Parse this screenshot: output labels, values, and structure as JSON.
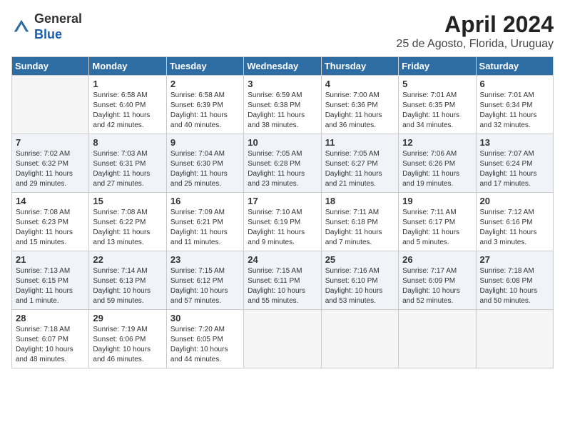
{
  "header": {
    "logo_line1": "General",
    "logo_line2": "Blue",
    "month_year": "April 2024",
    "location": "25 de Agosto, Florida, Uruguay"
  },
  "weekdays": [
    "Sunday",
    "Monday",
    "Tuesday",
    "Wednesday",
    "Thursday",
    "Friday",
    "Saturday"
  ],
  "weeks": [
    [
      {
        "day": "",
        "info": ""
      },
      {
        "day": "1",
        "info": "Sunrise: 6:58 AM\nSunset: 6:40 PM\nDaylight: 11 hours\nand 42 minutes."
      },
      {
        "day": "2",
        "info": "Sunrise: 6:58 AM\nSunset: 6:39 PM\nDaylight: 11 hours\nand 40 minutes."
      },
      {
        "day": "3",
        "info": "Sunrise: 6:59 AM\nSunset: 6:38 PM\nDaylight: 11 hours\nand 38 minutes."
      },
      {
        "day": "4",
        "info": "Sunrise: 7:00 AM\nSunset: 6:36 PM\nDaylight: 11 hours\nand 36 minutes."
      },
      {
        "day": "5",
        "info": "Sunrise: 7:01 AM\nSunset: 6:35 PM\nDaylight: 11 hours\nand 34 minutes."
      },
      {
        "day": "6",
        "info": "Sunrise: 7:01 AM\nSunset: 6:34 PM\nDaylight: 11 hours\nand 32 minutes."
      }
    ],
    [
      {
        "day": "7",
        "info": "Sunrise: 7:02 AM\nSunset: 6:32 PM\nDaylight: 11 hours\nand 29 minutes."
      },
      {
        "day": "8",
        "info": "Sunrise: 7:03 AM\nSunset: 6:31 PM\nDaylight: 11 hours\nand 27 minutes."
      },
      {
        "day": "9",
        "info": "Sunrise: 7:04 AM\nSunset: 6:30 PM\nDaylight: 11 hours\nand 25 minutes."
      },
      {
        "day": "10",
        "info": "Sunrise: 7:05 AM\nSunset: 6:28 PM\nDaylight: 11 hours\nand 23 minutes."
      },
      {
        "day": "11",
        "info": "Sunrise: 7:05 AM\nSunset: 6:27 PM\nDaylight: 11 hours\nand 21 minutes."
      },
      {
        "day": "12",
        "info": "Sunrise: 7:06 AM\nSunset: 6:26 PM\nDaylight: 11 hours\nand 19 minutes."
      },
      {
        "day": "13",
        "info": "Sunrise: 7:07 AM\nSunset: 6:24 PM\nDaylight: 11 hours\nand 17 minutes."
      }
    ],
    [
      {
        "day": "14",
        "info": "Sunrise: 7:08 AM\nSunset: 6:23 PM\nDaylight: 11 hours\nand 15 minutes."
      },
      {
        "day": "15",
        "info": "Sunrise: 7:08 AM\nSunset: 6:22 PM\nDaylight: 11 hours\nand 13 minutes."
      },
      {
        "day": "16",
        "info": "Sunrise: 7:09 AM\nSunset: 6:21 PM\nDaylight: 11 hours\nand 11 minutes."
      },
      {
        "day": "17",
        "info": "Sunrise: 7:10 AM\nSunset: 6:19 PM\nDaylight: 11 hours\nand 9 minutes."
      },
      {
        "day": "18",
        "info": "Sunrise: 7:11 AM\nSunset: 6:18 PM\nDaylight: 11 hours\nand 7 minutes."
      },
      {
        "day": "19",
        "info": "Sunrise: 7:11 AM\nSunset: 6:17 PM\nDaylight: 11 hours\nand 5 minutes."
      },
      {
        "day": "20",
        "info": "Sunrise: 7:12 AM\nSunset: 6:16 PM\nDaylight: 11 hours\nand 3 minutes."
      }
    ],
    [
      {
        "day": "21",
        "info": "Sunrise: 7:13 AM\nSunset: 6:15 PM\nDaylight: 11 hours\nand 1 minute."
      },
      {
        "day": "22",
        "info": "Sunrise: 7:14 AM\nSunset: 6:13 PM\nDaylight: 10 hours\nand 59 minutes."
      },
      {
        "day": "23",
        "info": "Sunrise: 7:15 AM\nSunset: 6:12 PM\nDaylight: 10 hours\nand 57 minutes."
      },
      {
        "day": "24",
        "info": "Sunrise: 7:15 AM\nSunset: 6:11 PM\nDaylight: 10 hours\nand 55 minutes."
      },
      {
        "day": "25",
        "info": "Sunrise: 7:16 AM\nSunset: 6:10 PM\nDaylight: 10 hours\nand 53 minutes."
      },
      {
        "day": "26",
        "info": "Sunrise: 7:17 AM\nSunset: 6:09 PM\nDaylight: 10 hours\nand 52 minutes."
      },
      {
        "day": "27",
        "info": "Sunrise: 7:18 AM\nSunset: 6:08 PM\nDaylight: 10 hours\nand 50 minutes."
      }
    ],
    [
      {
        "day": "28",
        "info": "Sunrise: 7:18 AM\nSunset: 6:07 PM\nDaylight: 10 hours\nand 48 minutes."
      },
      {
        "day": "29",
        "info": "Sunrise: 7:19 AM\nSunset: 6:06 PM\nDaylight: 10 hours\nand 46 minutes."
      },
      {
        "day": "30",
        "info": "Sunrise: 7:20 AM\nSunset: 6:05 PM\nDaylight: 10 hours\nand 44 minutes."
      },
      {
        "day": "",
        "info": ""
      },
      {
        "day": "",
        "info": ""
      },
      {
        "day": "",
        "info": ""
      },
      {
        "day": "",
        "info": ""
      }
    ]
  ]
}
